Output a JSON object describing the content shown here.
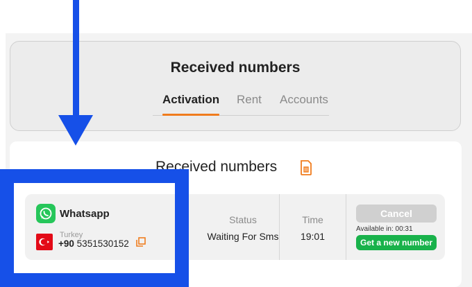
{
  "header": {
    "title": "Received numbers",
    "tabs": [
      {
        "label": "Activation",
        "active": true
      },
      {
        "label": "Rent",
        "active": false
      },
      {
        "label": "Accounts",
        "active": false
      }
    ]
  },
  "main": {
    "title": "Received numbers",
    "icon": "sim-card-icon"
  },
  "order": {
    "service": "Whatsapp",
    "country": "Turkey",
    "country_code": "+90",
    "number": "5351530152",
    "status_label": "Status",
    "status_value": "Waiting For Sms",
    "time_label": "Time",
    "time_value": "19:01",
    "cancel_label": "Cancel",
    "available_text": "Available in: 00:31",
    "new_number_label": "Get a new number"
  },
  "colors": {
    "accent": "#f07c1d",
    "whatsapp": "#26c65a",
    "new_number": "#19b24b",
    "annotation": "#1650e8"
  }
}
